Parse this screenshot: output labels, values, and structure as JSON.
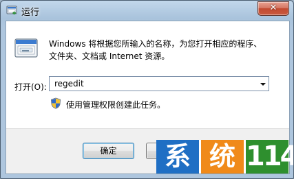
{
  "window": {
    "title": "运行",
    "close_glyph": "✕"
  },
  "dialog": {
    "description": "Windows 将根据您所输入的名称，为您打开相应的程序、文件夹、文档或 Internet 资源。",
    "open_label": "打开(O):",
    "command_value": "regedit",
    "admin_note": "使用管理权限创建此任务。"
  },
  "buttons": {
    "ok_label": "确定",
    "cancel_label": ""
  },
  "watermark": {
    "char1": "系",
    "char2": "统",
    "char3": "114"
  },
  "icons": [
    "run-app-icon",
    "run-program-icon",
    "uac-shield-icon",
    "dropdown-arrow-icon",
    "close-icon"
  ],
  "colors": {
    "title_gradient": "#b4cce3",
    "close_button": "#c24a31",
    "button_focus_border": "#3c7fb1",
    "watermark_blue": "#1f6fc4",
    "watermark_orange": "#f08a1a",
    "watermark_green": "#2e8f2e"
  }
}
